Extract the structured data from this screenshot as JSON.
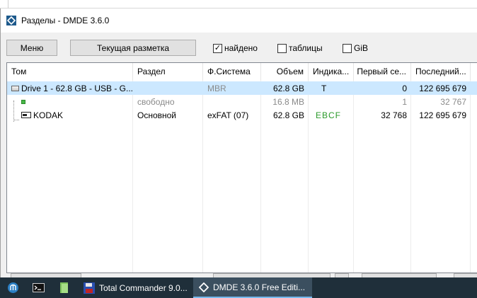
{
  "window": {
    "title": "Разделы - DMDE 3.6.0"
  },
  "toolbar": {
    "menu_label": "Меню",
    "layout_label": "Текущая разметка",
    "found_label": "найдено",
    "found_checked": true,
    "tables_label": "таблицы",
    "tables_checked": false,
    "gib_label": "GiB",
    "gib_checked": false
  },
  "table": {
    "columns": [
      "Том",
      "Раздел",
      "Ф.Система",
      "Объем",
      "Индика...",
      "Первый се...",
      "Последний..."
    ],
    "rows": [
      {
        "volume": "Drive 1 - 62.8 GB - USB - G...",
        "partition": "",
        "fs": "MBR",
        "size": "62.8 GB",
        "indicators": "T",
        "first": "0",
        "last": "122 695 679"
      },
      {
        "volume": "",
        "partition": "свободно",
        "fs": "",
        "size": "16.8 MB",
        "indicators": "",
        "first": "1",
        "last": "32 767"
      },
      {
        "volume": "KODAK",
        "partition": "Основной",
        "fs": "exFAT (07)",
        "size": "62.8 GB",
        "indicators": "EBCF",
        "first": "32 768",
        "last": "122 695 679"
      }
    ]
  },
  "taskbar": {
    "items": [
      {
        "label": "Total Commander 9.0..."
      },
      {
        "label": "DMDE 3.6.0 Free Editi..."
      }
    ]
  },
  "colors": {
    "selection": "#cce8ff",
    "accent": "#76b9ed",
    "taskbar": "#1f2f3a",
    "indicator_green": "#2a9a2a"
  }
}
